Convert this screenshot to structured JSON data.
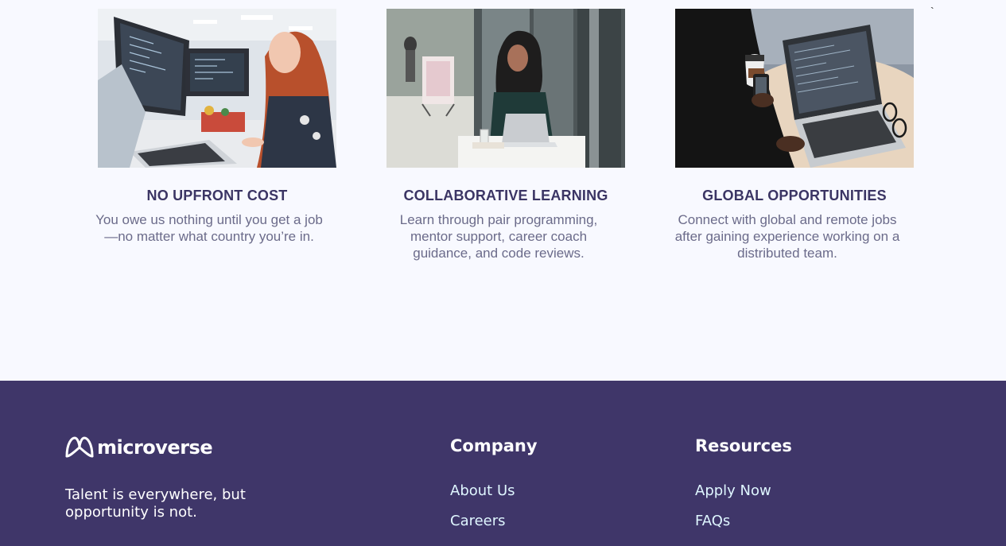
{
  "features": [
    {
      "image": "woman-at-desktop-monitors-photo",
      "title": "NO UPFRONT COST",
      "text": "You owe us nothing until you get a job—no matter what country you’re in."
    },
    {
      "image": "woman-laptop-cafe-photo",
      "title": "COLLABORATIVE LEARNING",
      "text": "Learn through pair programming, mentor support, career coach guidance, and code reviews."
    },
    {
      "image": "laptop-and-phone-on-table-photo",
      "title": "GLOBAL OPPORTUNITIES",
      "text": "Connect with global and remote jobs after gaining experience working on a distributed team."
    }
  ],
  "stray_mark": "`",
  "footer": {
    "logo_text": "microverse",
    "tagline": "Talent is everywhere, but opportunity is not.",
    "company": {
      "title": "Company",
      "links": [
        "About Us",
        "Careers"
      ]
    },
    "resources": {
      "title": "Resources",
      "links": [
        "Apply Now",
        "FAQs"
      ]
    }
  },
  "colors": {
    "page_bg": "#f8f9ff",
    "heading": "#3b3564",
    "body_text": "#6b6b8a",
    "footer_bg": "#3f3669",
    "footer_link": "#dff6ff"
  }
}
